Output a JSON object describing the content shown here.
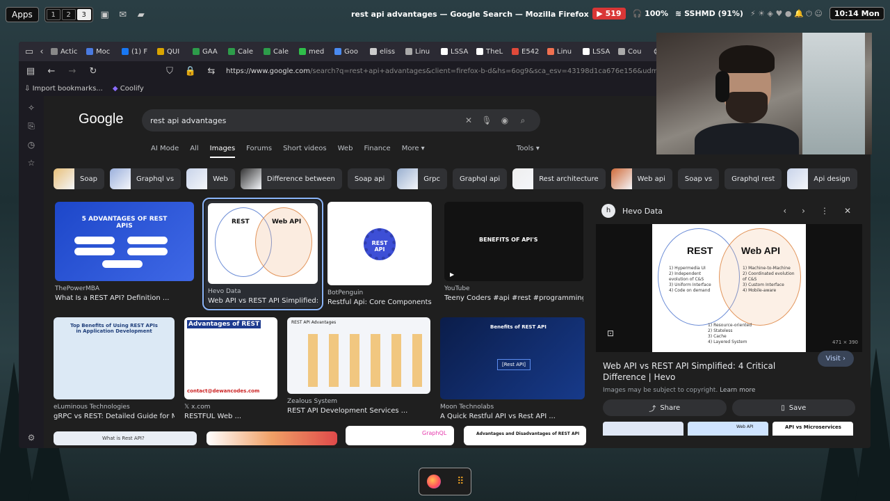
{
  "topbar": {
    "apps": "Apps",
    "workspaces": [
      "1",
      "2",
      "3"
    ],
    "window_title": "rest api advantages — Google Search — Mozilla Firefox",
    "notifications": "519",
    "volume": "100%",
    "wifi": "SSHMD (91%)",
    "clock": "10:14 Mon"
  },
  "tabs": [
    "Actic",
    "Moc",
    "(1) F",
    "QUI",
    "GAA",
    "Cale",
    "Cale",
    "med",
    "Goo",
    "eliss",
    "Linu",
    "LSSA",
    "TheL",
    "E542",
    "Linu",
    "LSSA",
    "Cou"
  ],
  "url": {
    "host": "https://www.google.com",
    "rest": "/search?q=rest+api+advantages&client=firefox-b-d&hs=6og9&sca_esv=43198d1ca676e156&udm=2&biw=1785&bih="
  },
  "bookmarks": [
    "Import bookmarks...",
    "Coolify"
  ],
  "google": {
    "logo": "Google",
    "query": "rest api advantages",
    "tabs": [
      "AI Mode",
      "All",
      "Images",
      "Forums",
      "Short videos",
      "Web",
      "Finance",
      "More"
    ],
    "tools": "Tools",
    "chips": [
      "Soap",
      "Graphql vs",
      "Web",
      "Difference between",
      "Soap api",
      "Grpc",
      "Graphql api",
      "Rest architecture",
      "Web api",
      "Soap vs",
      "Graphql rest",
      "Api design"
    ]
  },
  "results": [
    {
      "source": "ThePowerMBA",
      "caption": "What Is a REST API? Definition ...",
      "art": "5 ADVANTAGES OF REST APIS"
    },
    {
      "source": "Hevo Data",
      "caption": "Web API vs REST API Simplified: ..."
    },
    {
      "source": "BotPenguin",
      "caption": "Restful Api: Core Components ...",
      "art": "REST API"
    },
    {
      "source": "YouTube",
      "caption": "Teeny Coders #api #rest #programming ...",
      "art": "BENEFITS OF API'S"
    },
    {
      "source": "eLuminous Technologies",
      "caption": "gRPC vs REST: Detailed Guide for M...",
      "art": "Top Benefits of Using REST APIs in Application Development"
    },
    {
      "source": "x.com",
      "caption": "RESTFUL Web ...",
      "art": "Advantages of REST",
      "footer": "contact@dewancodes.com"
    },
    {
      "source": "Zealous System",
      "caption": "REST API Development Services ...",
      "art": "REST API Advantages"
    },
    {
      "source": "Moon Technolabs",
      "caption": "A Quick Restful API vs Rest API ...",
      "art": "Benefits of REST API",
      "center": "[Rest API]"
    }
  ],
  "bottom_row": [
    "What is Rest API?",
    "",
    "GraphQL",
    "Advantages and Disadvantages of REST API"
  ],
  "panel": {
    "site": "Hevo Data",
    "avatar": "h",
    "venn_left": "REST",
    "venn_right": "Web API",
    "left_items": [
      "1) Hypermedia UI",
      "2) Independent evolution of C&S",
      "3) Uniform Interface",
      "4) Code on demand"
    ],
    "right_items": [
      "1) Machine-to-Machine",
      "2) Coordinated evolution of C&S",
      "3) Custom Interface",
      "4) Mobile-aware"
    ],
    "shared_items": [
      "1) Resource-oriented",
      "2) Stateless",
      "3) Cache",
      "4) Layered System"
    ],
    "size": "471 × 390",
    "title": "Web API vs REST API Simplified: 4 Critical Difference | Hevo",
    "visit": "Visit",
    "copyright": "Images may be subject to copyright.",
    "learn_more": "Learn more",
    "share": "Share",
    "save": "Save",
    "related": [
      "",
      "Web API",
      "API vs Microservices"
    ]
  }
}
